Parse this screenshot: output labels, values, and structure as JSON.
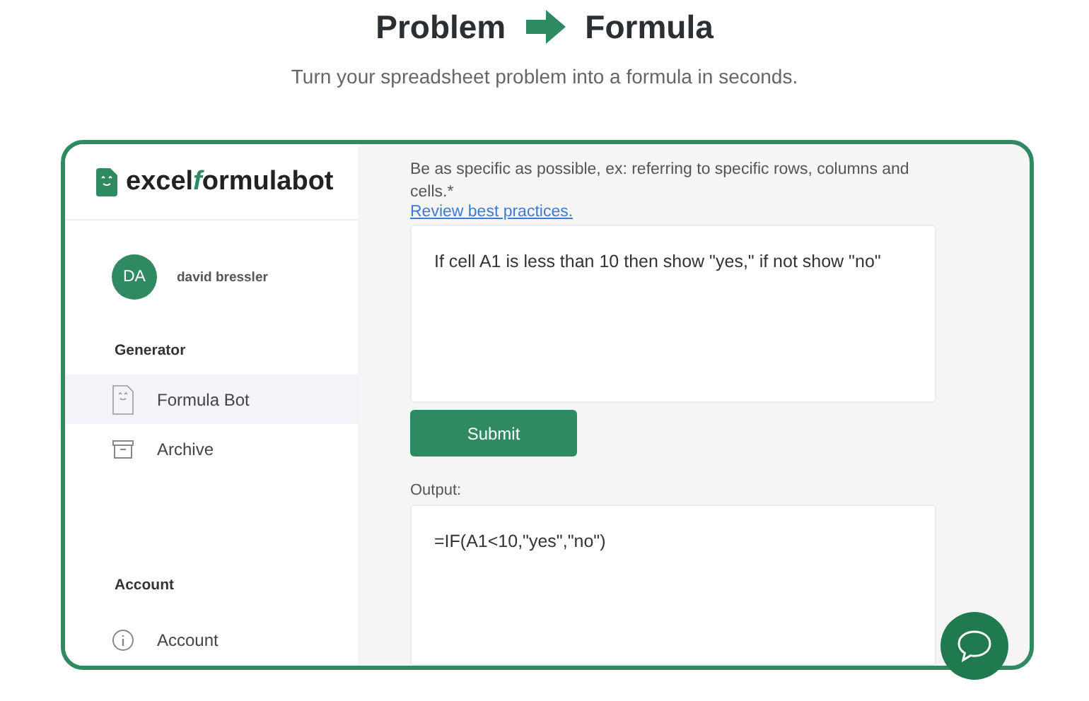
{
  "header": {
    "title_left": "Problem",
    "title_right": "Formula",
    "subtitle": "Turn your spreadsheet problem into a formula in seconds."
  },
  "sidebar": {
    "logo": {
      "before": "excel",
      "accent": "f",
      "after": "ormulabot"
    },
    "user": {
      "initials": "DA",
      "name": "david bressler"
    },
    "sections": [
      {
        "heading": "Generator",
        "items": [
          {
            "label": "Formula Bot",
            "kind": "bot",
            "selected": true
          },
          {
            "label": "Archive",
            "kind": "archive",
            "selected": false
          }
        ]
      },
      {
        "heading": "Account",
        "items": [
          {
            "label": "Account",
            "kind": "info",
            "selected": false
          }
        ]
      }
    ]
  },
  "main": {
    "instructions": "Be as specific as possible, ex: referring to specific rows, columns and cells.*",
    "link": "Review best practices.",
    "problem": {
      "value": "If cell A1 is less than 10 then show \"yes,\" if not show \"no\""
    },
    "submit": "Submit",
    "output_label": "Output:",
    "output": "=IF(A1<10,\"yes\",\"no\")"
  }
}
